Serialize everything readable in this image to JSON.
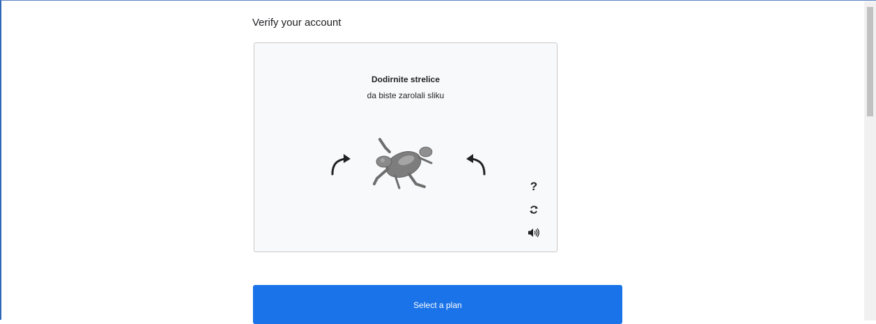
{
  "page": {
    "title": "Verify your account"
  },
  "captcha": {
    "instruction_title": "Dodirnite strelice",
    "instruction_subtitle": "da biste zarolali sliku",
    "help_label": "?",
    "icons": {
      "rotate_left": "curved-arrow-left-icon",
      "rotate_right": "curved-arrow-right-icon",
      "help": "question-mark-icon",
      "refresh": "refresh-icon",
      "audio": "speaker-icon"
    }
  },
  "actions": {
    "select_plan_label": "Select a plan"
  },
  "colors": {
    "accent": "#1a73e8",
    "panel_bg": "#f8f9fa",
    "frame_border": "#2f67b8"
  }
}
